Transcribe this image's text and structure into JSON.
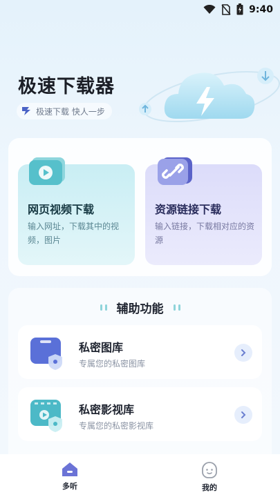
{
  "status_bar": {
    "time": "9:40",
    "icons": [
      "wifi-icon",
      "no-sim-icon",
      "battery-icon"
    ]
  },
  "header": {
    "app_title": "极速下载器",
    "slogan": "极速下载  快人一步",
    "slogan_icon": "download-badge-icon"
  },
  "hero": {
    "icon": "cloud-lightning-icon"
  },
  "features": [
    {
      "title": "网页视频下载",
      "description": "输入网址，下载其中的视频，图片",
      "icon": "video-play-icon"
    },
    {
      "title": "资源链接下载",
      "description": "输入链接，下载相对应的资源",
      "icon": "chain-link-icon"
    }
  ],
  "aux": {
    "title": "辅助功能",
    "items": [
      {
        "title": "私密图库",
        "subtitle": "专属您的私密图库",
        "icon": "private-gallery-icon"
      },
      {
        "title": "私密影视库",
        "subtitle": "专属您的私密影视库",
        "icon": "private-video-icon"
      }
    ]
  },
  "bottom_nav": {
    "items": [
      {
        "label": "多听",
        "icon": "home-icon",
        "active": true
      },
      {
        "label": "我的",
        "icon": "profile-icon",
        "active": false
      }
    ]
  },
  "colors": {
    "accent_teal": "#8fd4da",
    "accent_indigo": "#5b63c9",
    "home_active": "#6b73d6"
  }
}
